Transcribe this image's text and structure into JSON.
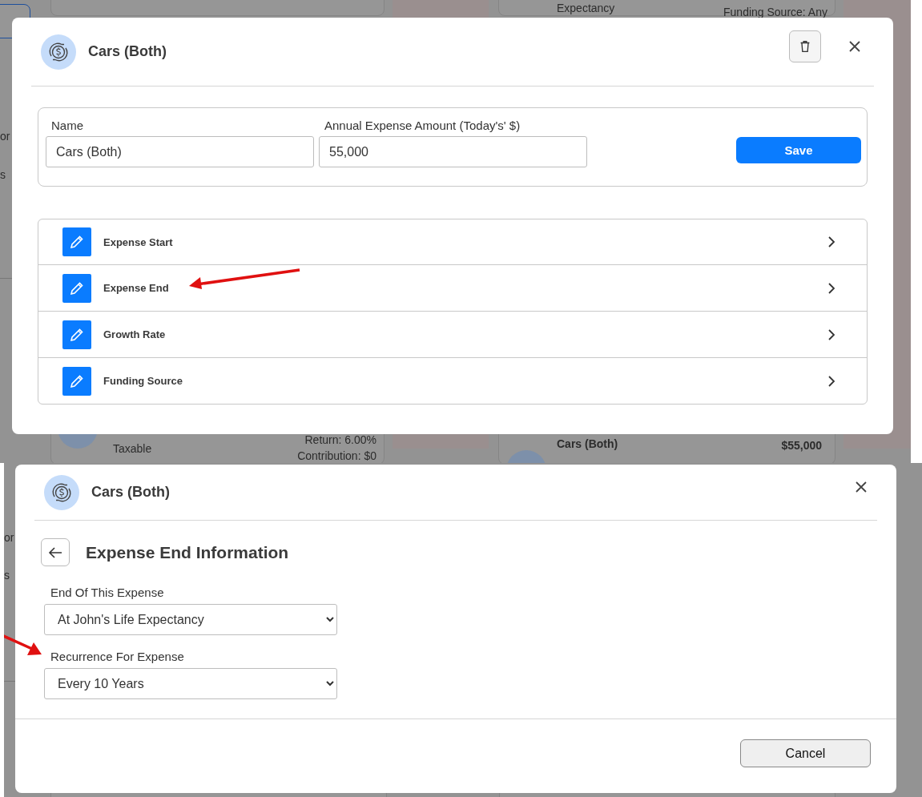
{
  "top_screen": {
    "background_texts": [
      {
        "text": "Expectancy",
        "bold": false
      },
      {
        "text": "Funding Source: Any",
        "bold": false
      },
      {
        "text": "or",
        "bold": false
      },
      {
        "text": "s",
        "bold": false
      },
      {
        "text": "Taxable",
        "bold": false
      },
      {
        "text": "Return: 6.00%",
        "bold": false
      },
      {
        "text": "Contribution: $0",
        "bold": false
      },
      {
        "text": "Cars (Both)",
        "bold": true
      },
      {
        "text": "$55,000",
        "bold": true
      }
    ],
    "modal": {
      "title": "Cars (Both)",
      "fields": [
        {
          "label": "Name",
          "value": "Cars (Both)"
        },
        {
          "label": "Annual Expense Amount (Today's' $)",
          "value": "55,000"
        }
      ],
      "save_button": "Save",
      "sections": [
        "Expense Start",
        "Expense End",
        "Growth Rate",
        "Funding Source"
      ]
    }
  },
  "bottom_screen": {
    "background_texts": [
      {
        "text": "or",
        "bold": false
      },
      {
        "text": "s",
        "bold": false
      }
    ],
    "modal": {
      "title": "Cars (Both)",
      "heading": "Expense End Information",
      "selects": [
        {
          "label": "End Of This Expense",
          "value": "At John's Life Expectancy"
        },
        {
          "label": "Recurrence For Expense",
          "value": "Every 10 Years"
        }
      ],
      "cancel_button": "Cancel"
    }
  }
}
